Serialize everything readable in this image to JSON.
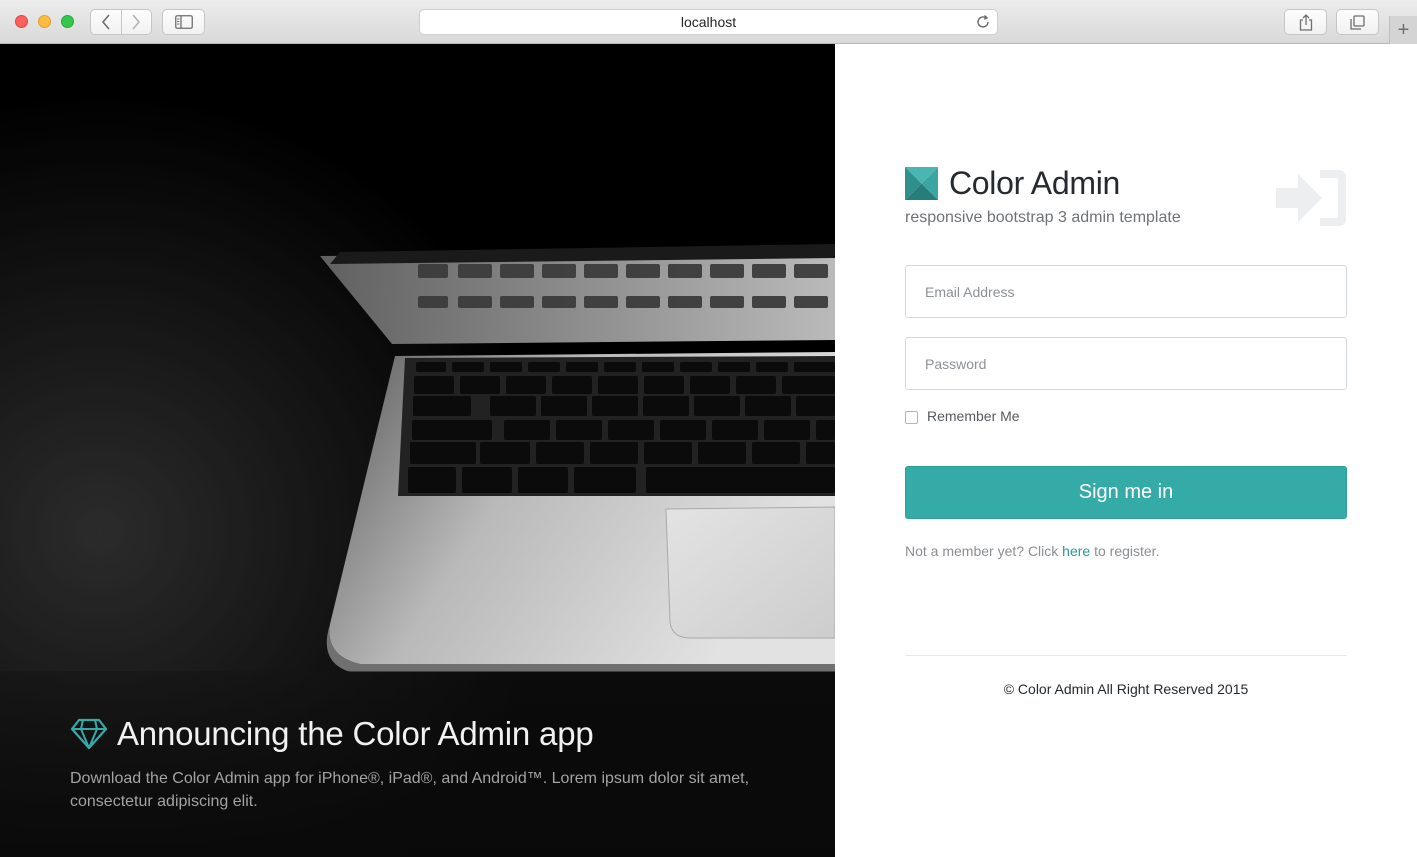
{
  "browser": {
    "address": "localhost",
    "icons": [
      "back-icon",
      "forward-icon",
      "sidebar-icon",
      "reload-icon",
      "share-icon",
      "tabs-icon",
      "plus-icon"
    ]
  },
  "hero": {
    "title": "Announcing the Color Admin app",
    "description": "Download the Color Admin app for iPhone®, iPad®, and Android™. Lorem ipsum dolor sit amet, consectetur adipiscing elit.",
    "icon": "diamond-icon",
    "accent": "#35aba8"
  },
  "login": {
    "brand_name": "Color Admin",
    "brand_sub": "responsive bootstrap 3 admin template",
    "email_placeholder": "Email Address",
    "password_placeholder": "Password",
    "remember_label": "Remember Me",
    "signin_label": "Sign me in",
    "register_prefix": "Not a member yet? Click",
    "register_link": "here",
    "register_suffix": "to register.",
    "copyright": "© Color Admin All Right Reserved 2015",
    "button_color": "#35aba8"
  }
}
